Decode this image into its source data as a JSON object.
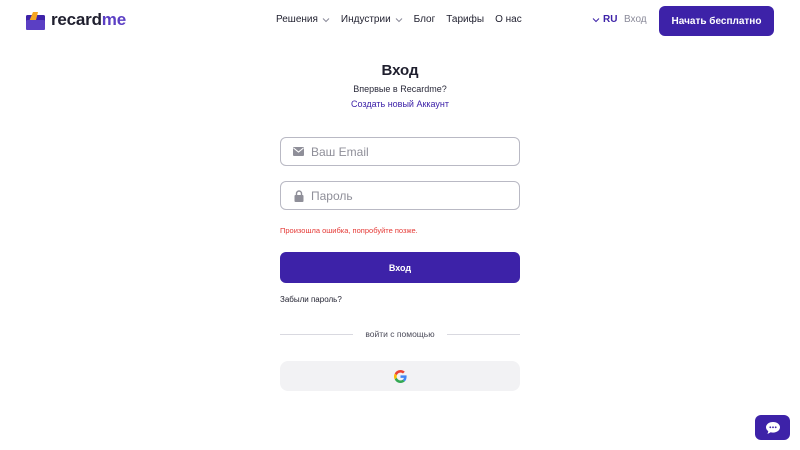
{
  "header": {
    "logo_text_main": "recard",
    "logo_text_accent": "me",
    "nav": [
      {
        "label": "Решения",
        "has_dropdown": true
      },
      {
        "label": "Индустрии",
        "has_dropdown": true
      },
      {
        "label": "Блог",
        "has_dropdown": false
      },
      {
        "label": "Тарифы",
        "has_dropdown": false
      },
      {
        "label": "О нас",
        "has_dropdown": false
      }
    ],
    "language": "RU",
    "login_label": "Вход",
    "cta_label": "Начать бесплатно"
  },
  "form": {
    "title": "Вход",
    "subtitle": "Впервые в Recardme?",
    "create_account_link": "Создать новый Аккаунт",
    "email_placeholder": "Ваш Email",
    "email_value": "",
    "password_placeholder": "Пароль",
    "password_value": "",
    "error_message": "Произошла ошибка, попробуйте позже.",
    "submit_label": "Вход",
    "forgot_password": "Забыли пароль?",
    "divider_text": "войти с помощью",
    "social_providers": [
      "google"
    ]
  },
  "colors": {
    "brand": "#3d22a8",
    "error": "#e53935",
    "google_button_bg": "#f2f2f4"
  },
  "icons": {
    "email": "envelope-icon",
    "password": "lock-icon",
    "google": "google-icon",
    "chat": "chat-bubble-icon"
  }
}
